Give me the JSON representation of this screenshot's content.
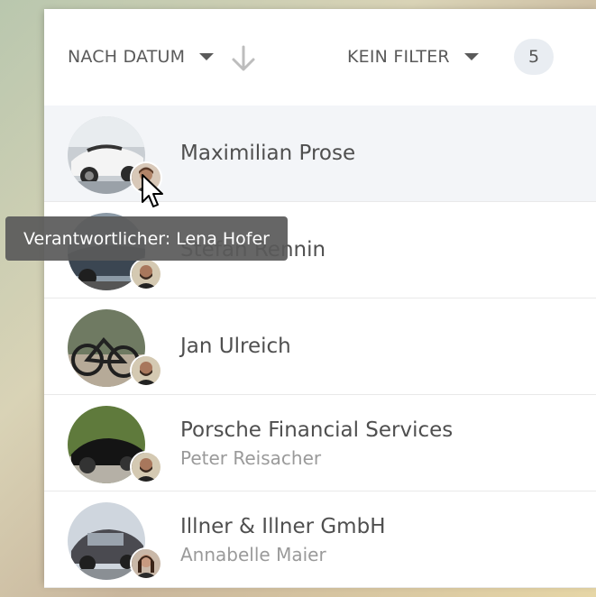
{
  "toolbar": {
    "sort_label": "NACH DATUM",
    "filter_label": "KEIN FILTER",
    "count": "5"
  },
  "contacts": [
    {
      "name": "Maximilian Prose",
      "subtitle": ""
    },
    {
      "name": "Stefan Rennin",
      "subtitle": ""
    },
    {
      "name": "Jan Ulreich",
      "subtitle": ""
    },
    {
      "name": "Porsche Financial Services",
      "subtitle": "Peter Reisacher"
    },
    {
      "name": "Illner & Illner GmbH",
      "subtitle": "Annabelle Maier"
    }
  ],
  "tooltip": {
    "text": "Verantwortlicher: Lena Hofer"
  },
  "colors": {
    "hover_row": "#f3f5f8",
    "badge_bg": "#e9edf2",
    "tooltip_bg": "#5a5a5a"
  }
}
